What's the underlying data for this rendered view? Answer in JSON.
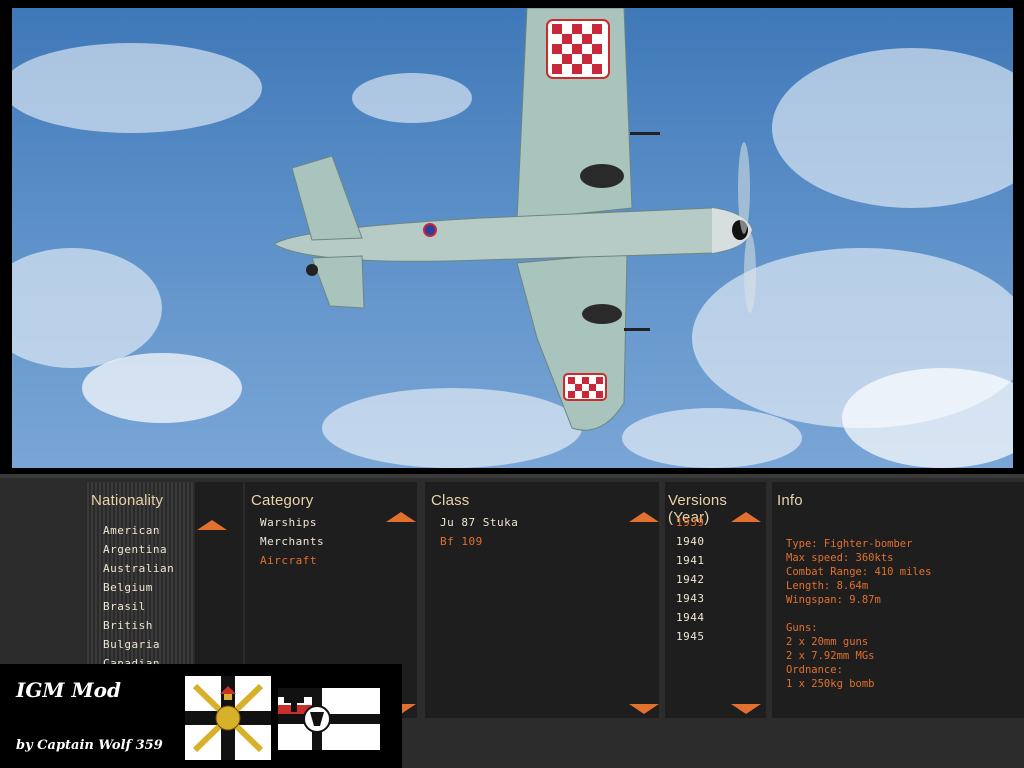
{
  "scene": {
    "description_hidden": true
  },
  "panels": {
    "nationality": {
      "title": "Nationality",
      "items": [
        "American",
        "Argentina",
        "Australian",
        "Belgium",
        "Brasil",
        "British",
        "Bulgaria",
        "Canadian"
      ]
    },
    "category": {
      "title": "Category",
      "items": [
        "Warships",
        "Merchants",
        "Aircraft"
      ],
      "selected": 2
    },
    "class": {
      "title": "Class",
      "items": [
        "Ju 87 Stuka",
        "Bf 109"
      ],
      "selected": 1
    },
    "versions": {
      "title": "Versions (Year)",
      "items": [
        "1939",
        "1940",
        "1941",
        "1942",
        "1943",
        "1944",
        "1945"
      ],
      "selected": 0
    },
    "info": {
      "title": "Info",
      "lines": [
        "Type: Fighter-bomber",
        "Max speed: 360kts",
        "Combat Range: 410 miles",
        "Length: 8.64m",
        "Wingspan: 9.87m",
        "",
        "Guns:",
        "2 x 20mm guns",
        "2 x 7.92mm MGs",
        "Ordnance:",
        "1 x 250kg bomb"
      ]
    }
  },
  "badge": {
    "title": "IGM Mod",
    "subtitle": "by Captain Wolf 359"
  },
  "colors": {
    "accent": "#e2702e",
    "text": "#f0e6d2",
    "panel": "#1e1e1e",
    "background": "#2c2c2c"
  }
}
